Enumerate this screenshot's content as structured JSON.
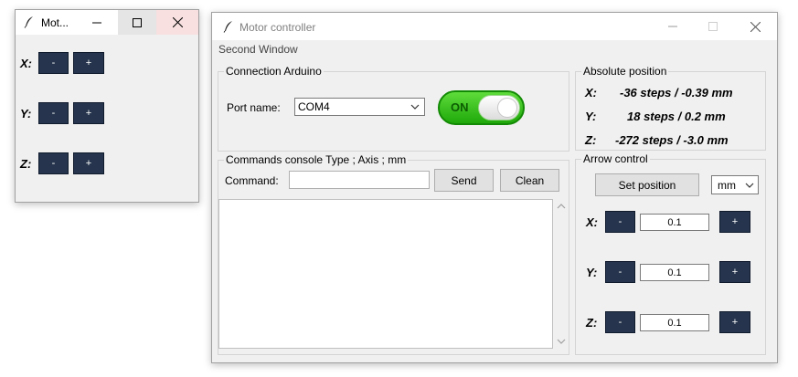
{
  "small_window": {
    "title": "Mot...",
    "axes": [
      {
        "label": "X:",
        "minus": "-",
        "plus": "+"
      },
      {
        "label": "Y:",
        "minus": "-",
        "plus": "+"
      },
      {
        "label": "Z:",
        "minus": "-",
        "plus": "+"
      }
    ]
  },
  "main_window": {
    "title": "Motor controller",
    "menu": "Second Window",
    "connection": {
      "group_title": "Connection Arduino",
      "port_label": "Port name:",
      "port_value": "COM4",
      "toggle_text": "ON",
      "toggle_color": "#22bb11"
    },
    "console": {
      "group_title": "Commands console Type ; Axis ; mm",
      "command_label": "Command:",
      "command_value": "",
      "send_label": "Send",
      "clean_label": "Clean",
      "output": ""
    },
    "absolute_position": {
      "group_title": "Absolute position",
      "rows": [
        {
          "axis": "X:",
          "value": "-36 steps / -0.39 mm"
        },
        {
          "axis": "Y:",
          "value": "18 steps / 0.2 mm"
        },
        {
          "axis": "Z:",
          "value": "-272 steps / -3.0 mm"
        }
      ]
    },
    "arrow_control": {
      "group_title": "Arrow control",
      "set_position_label": "Set position",
      "unit_value": "mm",
      "axes": [
        {
          "label": "X:",
          "minus": "-",
          "step": "0.1",
          "plus": "+"
        },
        {
          "label": "Y:",
          "minus": "-",
          "step": "0.1",
          "plus": "+"
        },
        {
          "label": "Z:",
          "minus": "-",
          "step": "0.1",
          "plus": "+"
        }
      ]
    }
  }
}
